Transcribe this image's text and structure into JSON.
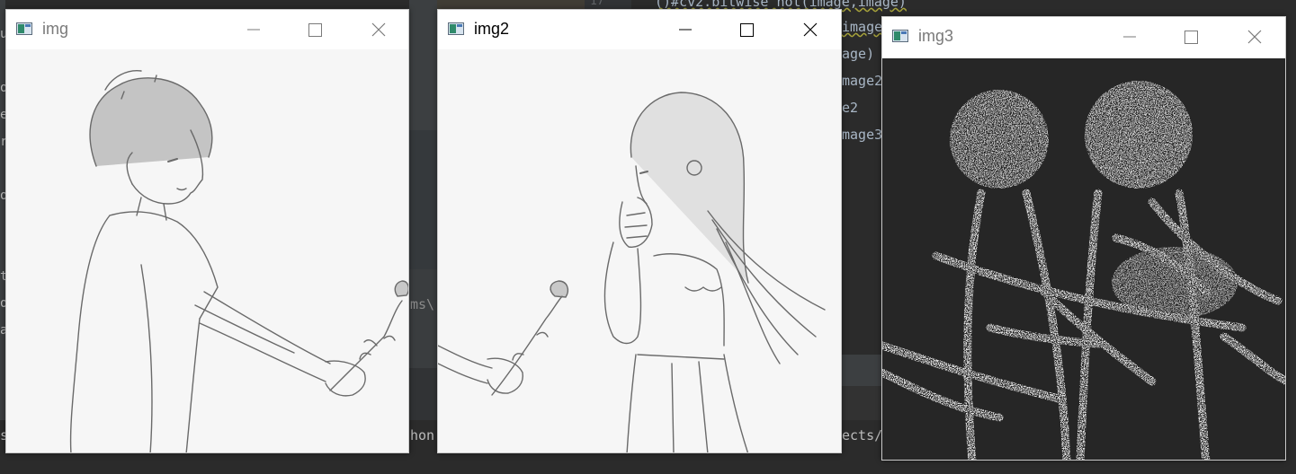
{
  "ide": {
    "line_number": "17",
    "code_lines": [
      "()#cv2.bitwise_not(image,image)",
      "image2,",
      "age)",
      "mage2",
      "e2",
      "mage3"
    ],
    "side_chars": [
      "u",
      "o",
      "e",
      "r",
      "o",
      "t",
      "o",
      "a"
    ],
    "path_fragment": "ms\\",
    "bottom_left": "s",
    "bottom_mid": "hon",
    "bottom_right": "ects/"
  },
  "windows": [
    {
      "title": "img",
      "active": false
    },
    {
      "title": "img2",
      "active": true
    },
    {
      "title": "img3",
      "active": false
    }
  ],
  "colors": {
    "inactive_title": "#7a7a7a",
    "active_title": "#000000",
    "sketch_bg": "#f6f6f6",
    "dark_bg": "#262626"
  },
  "icons": {
    "app": "opencv-window-icon",
    "minimize": "minimize-icon",
    "maximize": "maximize-icon",
    "close": "close-icon"
  }
}
